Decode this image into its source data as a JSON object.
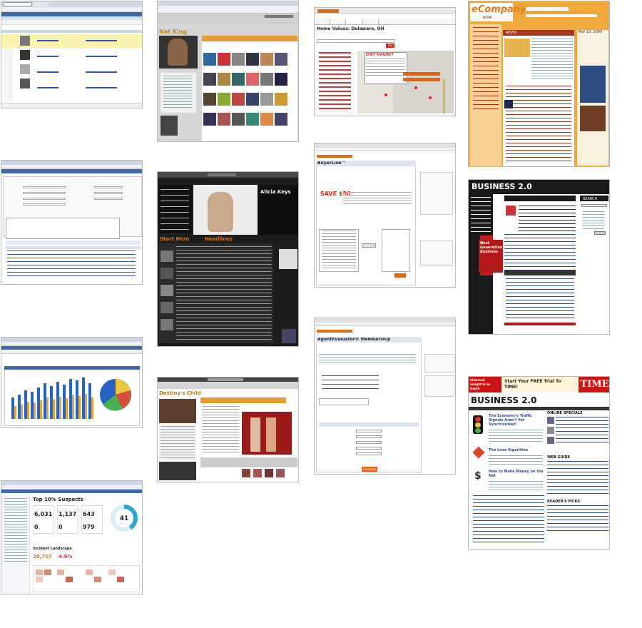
{
  "screenshots": [
    {
      "id": "brand-protection-list",
      "label": ""
    },
    {
      "id": "nat-king-cole",
      "label": "Nat King Cole"
    },
    {
      "id": "home-values",
      "title": "Home Values: Delaware, OH",
      "banner_label": "DIRT MAGNET",
      "button": "Go"
    },
    {
      "id": "ecompany",
      "logo": "eCompany",
      "sub": "NOW",
      "section": "NEWS",
      "date": "Mar 10, 2000"
    },
    {
      "id": "brand-protection-form",
      "label": ""
    },
    {
      "id": "alicia-keys",
      "label": "Alicia Keys",
      "side_heading": "Start Here",
      "news_heading": "Headlines"
    },
    {
      "id": "buyer-link",
      "heading": "BuyerLink™",
      "promo": "SAVE $50"
    },
    {
      "id": "business20-a",
      "logo": "BUSINESS 2.0",
      "feature": "Next Generation Business",
      "side": "SEARCH"
    },
    {
      "id": "brand-protection-chart",
      "label": ""
    },
    {
      "id": "destinys-child",
      "label": "Destiny's Child"
    },
    {
      "id": "agent-evaluator",
      "heading": "AgentEvaluator® Membership",
      "button": "Continue"
    },
    {
      "id": "business20-b",
      "logo": "BUSINESS 2.0",
      "banner_left": "Informed Insightful In-Depth",
      "banner_mid": "Start Your FREE Trial To TIME!",
      "banner_right": "TIME",
      "headline": "The Economy's Traffic Signals Aren't Yet Synchronized",
      "story2": "The Love Algorithm",
      "story3": "How to Make Money on the Net",
      "col_heading": "ONLINE SPECIALS",
      "web_guide": "WEB GUIDE",
      "readers_picks": "READER'S PICKS"
    },
    {
      "id": "brand-protection-dashboard",
      "heading": "Top 10% Suspects",
      "stats": [
        "6,031",
        "1,137",
        "643",
        "0",
        "0",
        "979"
      ],
      "stats2": [
        "20,707",
        "4.9%"
      ],
      "donut": "41",
      "section": "Incident Landscape"
    }
  ],
  "colors": {
    "orange": "#e6761e",
    "navy": "#2a4a8a",
    "red": "#cc1111",
    "ecomp_bg": "#f0a93c",
    "dark": "#1d1d1d"
  }
}
